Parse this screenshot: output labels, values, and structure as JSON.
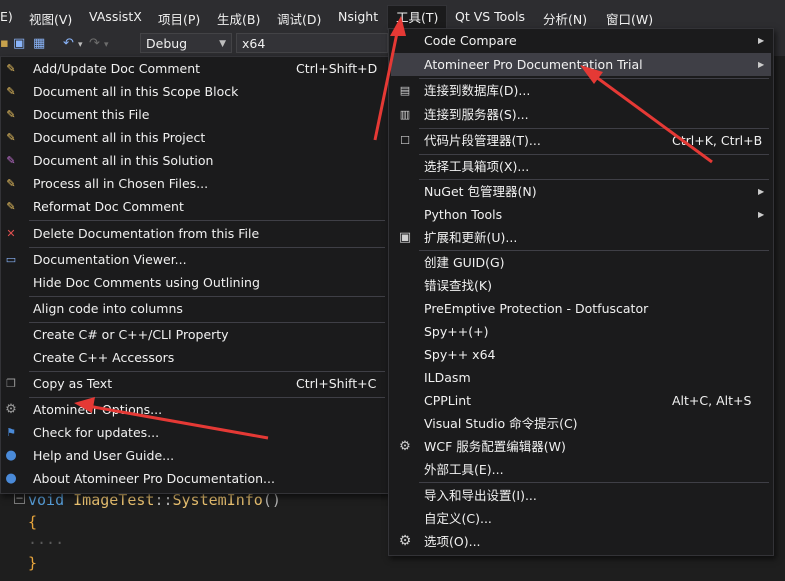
{
  "menubar": {
    "items": [
      {
        "label": "E)"
      },
      {
        "label": "视图(V)"
      },
      {
        "label": "VAssistX"
      },
      {
        "label": "项目(P)"
      },
      {
        "label": "生成(B)"
      },
      {
        "label": "调试(D)"
      },
      {
        "label": "Nsight"
      },
      {
        "label": "工具(T)"
      },
      {
        "label": "Qt VS Tools"
      },
      {
        "label": "分析(N)"
      },
      {
        "label": "窗口(W)"
      }
    ]
  },
  "toolbar": {
    "config": "Debug",
    "platform": "x64"
  },
  "code": {
    "line1_kw": "void",
    "line1_cls": "ImageTest",
    "line1_sep": "::",
    "line1_fn": "SystemInfo",
    "line1_paren": "()",
    "open_brace": "{",
    "dots": "····",
    "close_brace": "}"
  },
  "left_menu": {
    "items": [
      {
        "label": "Add/Update Doc Comment",
        "shortcut": "Ctrl+Shift+D"
      },
      {
        "label": "Document all in this Scope Block",
        "shortcut": ""
      },
      {
        "label": "Document this File",
        "shortcut": ""
      },
      {
        "label": "Document all in this Project",
        "shortcut": ""
      },
      {
        "label": "Document all in this Solution",
        "shortcut": ""
      },
      {
        "label": "Process all in Chosen Files...",
        "shortcut": ""
      },
      {
        "label": "Reformat Doc Comment",
        "shortcut": ""
      },
      {
        "label": "Delete Documentation from this File",
        "shortcut": ""
      },
      {
        "label": "Documentation Viewer...",
        "shortcut": ""
      },
      {
        "label": "Hide Doc Comments using Outlining",
        "shortcut": ""
      },
      {
        "label": "Align code into columns",
        "shortcut": ""
      },
      {
        "label": "Create C# or C++/CLI Property",
        "shortcut": ""
      },
      {
        "label": "Create C++ Accessors",
        "shortcut": ""
      },
      {
        "label": "Copy as Text",
        "shortcut": "Ctrl+Shift+C"
      },
      {
        "label": "Atomineer Options...",
        "shortcut": ""
      },
      {
        "label": "Check for updates...",
        "shortcut": ""
      },
      {
        "label": "Help and User Guide...",
        "shortcut": ""
      },
      {
        "label": "About Atomineer Pro Documentation...",
        "shortcut": ""
      }
    ]
  },
  "tools_menu": {
    "items": [
      {
        "label": "Code Compare",
        "shortcut": ""
      },
      {
        "label": "Atomineer Pro Documentation Trial",
        "shortcut": ""
      },
      {
        "label": "连接到数据库(D)...",
        "shortcut": ""
      },
      {
        "label": "连接到服务器(S)...",
        "shortcut": ""
      },
      {
        "label": "代码片段管理器(T)...",
        "shortcut": "Ctrl+K, Ctrl+B"
      },
      {
        "label": "选择工具箱项(X)...",
        "shortcut": ""
      },
      {
        "label": "NuGet 包管理器(N)",
        "shortcut": ""
      },
      {
        "label": "Python Tools",
        "shortcut": ""
      },
      {
        "label": "扩展和更新(U)...",
        "shortcut": ""
      },
      {
        "label": "创建 GUID(G)",
        "shortcut": ""
      },
      {
        "label": "错误查找(K)",
        "shortcut": ""
      },
      {
        "label": "PreEmptive Protection - Dotfuscator",
        "shortcut": ""
      },
      {
        "label": "Spy++(+)",
        "shortcut": ""
      },
      {
        "label": "Spy++ x64",
        "shortcut": ""
      },
      {
        "label": "ILDasm",
        "shortcut": ""
      },
      {
        "label": "CPPLint",
        "shortcut": "Alt+C, Alt+S"
      },
      {
        "label": "Visual Studio 命令提示(C)",
        "shortcut": ""
      },
      {
        "label": "WCF 服务配置编辑器(W)",
        "shortcut": ""
      },
      {
        "label": "外部工具(E)...",
        "shortcut": ""
      },
      {
        "label": "导入和导出设置(I)...",
        "shortcut": ""
      },
      {
        "label": "自定义(C)...",
        "shortcut": ""
      },
      {
        "label": "选项(O)...",
        "shortcut": ""
      }
    ]
  },
  "colors": {
    "menu_bg": "#1b1b1c",
    "highlight": "#3f3f46",
    "annotation_arrow": "#e53935"
  }
}
